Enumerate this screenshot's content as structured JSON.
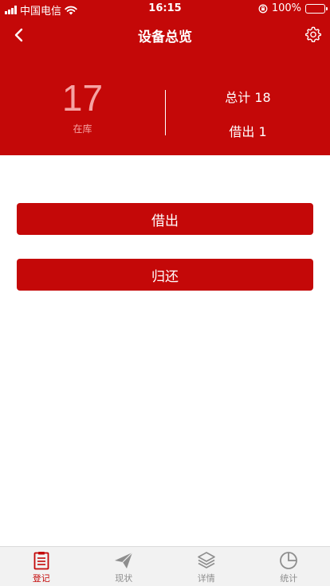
{
  "status_bar": {
    "carrier": "中国电信",
    "time": "16:15",
    "battery": "100%",
    "battery_level": 1.0
  },
  "nav": {
    "title": "设备总览",
    "back_icon": "chevron-left-icon",
    "settings_icon": "gear-icon"
  },
  "summary": {
    "in_stock_count": "17",
    "in_stock_label": "在库",
    "total": "总计 18",
    "borrowed": "借出 1"
  },
  "actions": {
    "borrow_label": "借出",
    "return_label": "归还"
  },
  "tabs": [
    {
      "label": "登记",
      "icon": "clipboard-icon",
      "active": true
    },
    {
      "label": "现状",
      "icon": "paper-plane-icon",
      "active": false
    },
    {
      "label": "详情",
      "icon": "layers-icon",
      "active": false
    },
    {
      "label": "统计",
      "icon": "pie-chart-icon",
      "active": false
    }
  ],
  "colors": {
    "primary": "#c40808",
    "instock_number": "#f6a3a3",
    "tab_inactive": "#8e8e8e",
    "tab_bar_bg": "#f2f2f2"
  }
}
